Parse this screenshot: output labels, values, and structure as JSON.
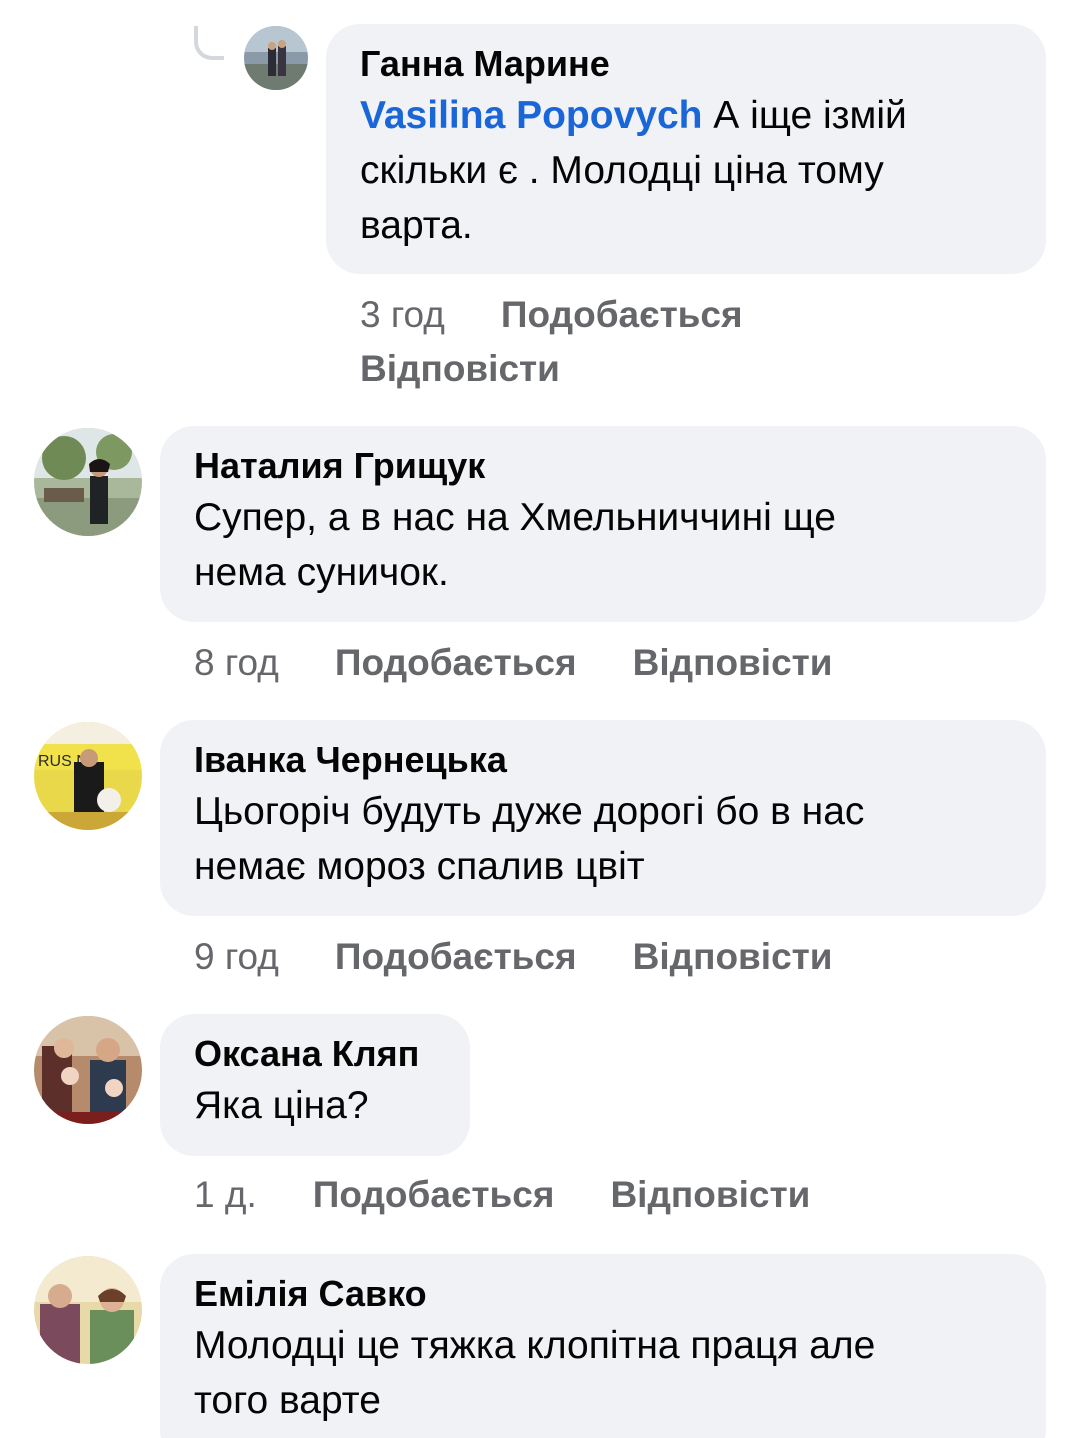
{
  "comments": [
    {
      "author": "Ганна Марине",
      "mention": "Vasilina Popovych",
      "text_line1": " А іще ізмій",
      "text_line2": "скільки є . Молодці ціна тому",
      "text_line3": "варта.",
      "time": "3 год",
      "like_label": "Подобається",
      "reply_label": "Відповісти"
    },
    {
      "author": "Наталия Грищук",
      "text_line1": "Супер, а в нас на Хмельниччині ще",
      "text_line2": "нема суничок.",
      "time": "8 год",
      "like_label": "Подобається",
      "reply_label": "Відповісти"
    },
    {
      "author": "Іванка Чернецька",
      "text_line1": "Цьогоріч будуть дуже дорогі бо в нас",
      "text_line2": "немає мороз спалив цвіт",
      "time": "9 год",
      "like_label": "Подобається",
      "reply_label": "Відповісти",
      "avatar_text": "RUS NA"
    },
    {
      "author": "Оксана Кляп",
      "text_line1": "Яка ціна?",
      "time": "1 д.",
      "like_label": "Подобається",
      "reply_label": "Відповісти"
    },
    {
      "author": "Емілія Савко",
      "text_line1": "Молодці це тяжка клопітна  праця але",
      "text_line2": "того варте"
    }
  ],
  "colors": {
    "bubble_bg": "#f0f2f5",
    "mention": "#1a66d9",
    "meta_text": "#65676b",
    "author_text": "#050505"
  }
}
